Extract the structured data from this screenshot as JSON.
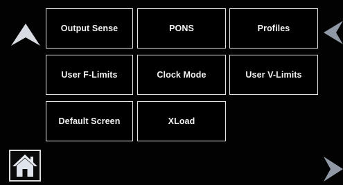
{
  "menu": {
    "items": [
      {
        "label": "Output Sense"
      },
      {
        "label": "PONS"
      },
      {
        "label": "Profiles"
      },
      {
        "label": "User F-Limits"
      },
      {
        "label": "Clock Mode"
      },
      {
        "label": "User V-Limits"
      },
      {
        "label": "Default Screen"
      },
      {
        "label": "XLoad"
      }
    ]
  },
  "navigation": {
    "up_icon": "arrow-up-icon",
    "left_icon": "arrow-left-icon",
    "right_icon": "arrow-right-icon",
    "home_icon": "home-icon"
  },
  "colors": {
    "background": "#000000",
    "button_border": "#e6e6e6",
    "text": "#f2f2f2",
    "arrow_up": "#d8dce2",
    "arrow_side": "#8f98a4"
  }
}
